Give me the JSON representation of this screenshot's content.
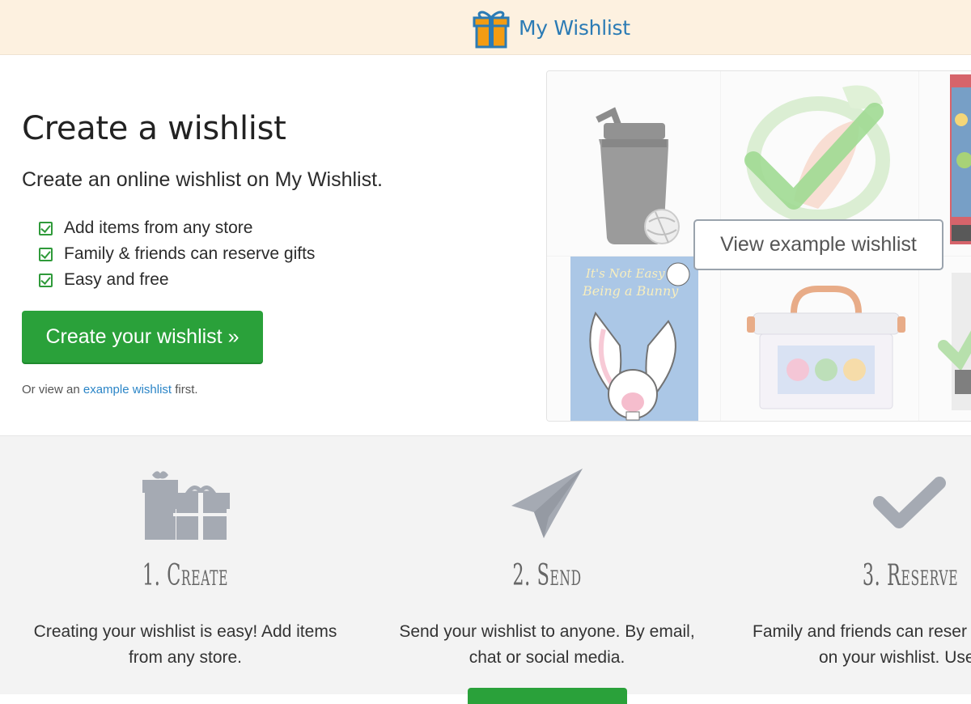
{
  "header": {
    "brand_name": "My Wishlist",
    "brand_color": "#2b7bb5",
    "logo_icon": "gift-box-icon",
    "background": "#fdf1e0"
  },
  "hero": {
    "title": "Create a wishlist",
    "subtitle": "Create an online wishlist on My Wishlist.",
    "features": [
      "Add items from any store",
      "Family & friends can reserve gifts",
      "Easy and free"
    ],
    "cta_label": "Create your wishlist »",
    "cta_color": "#2aa13a",
    "alt_prefix": "Or view an",
    "alt_link": "example wishlist",
    "alt_suffix": "first."
  },
  "example": {
    "view_button_label": "View example wishlist",
    "book_title_line1": "It's Not Easy",
    "book_title_line2": "Being a Bunny",
    "items": [
      "shaker-bottle",
      "teether-toy",
      "game-box",
      "bunny-book",
      "craft-kit",
      "game-case"
    ]
  },
  "steps": [
    {
      "icon": "gift-icon",
      "title": "1. Create",
      "desc": "Creating your wishlist is easy! Add items from any store."
    },
    {
      "icon": "paper-plane-icon",
      "title": "2. Send",
      "desc": "Send your wishlist to anyone. By email, chat or social media."
    },
    {
      "icon": "checkmark-icon",
      "title": "3. Reserve",
      "desc_line1": "Family and friends can reser",
      "desc_line2": "on your wishlist. Use"
    }
  ]
}
